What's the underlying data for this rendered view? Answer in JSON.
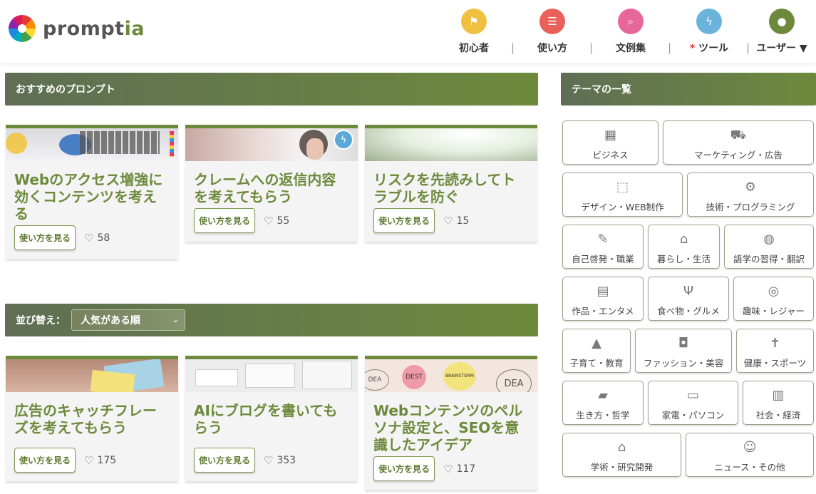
{
  "header": {
    "logo_text_main": "prompt",
    "logo_text_accent": "ia",
    "nav": [
      {
        "label": "初心者",
        "icon": "flag-icon",
        "color": "#f0c040",
        "glyph": "⚑"
      },
      {
        "label": "使い方",
        "icon": "list-icon",
        "color": "#e8625a",
        "glyph": "☰"
      },
      {
        "label": "文例集",
        "icon": "search-icon",
        "color": "#e7679a",
        "glyph": "⌕"
      },
      {
        "label": "ツール",
        "star": "*",
        "icon": "bolt-icon",
        "color": "#6ab4dc",
        "glyph": "ϟ"
      },
      {
        "label": "ユーザー ▼",
        "icon": "user-icon",
        "color": "#6d8a3c",
        "glyph": "●"
      }
    ],
    "separator": "|"
  },
  "recommended": {
    "heading": "おすすめのプロンプト",
    "cards": [
      {
        "title": "Webのアクセス増強に効くコンテンツを考える",
        "button": "使い方を見る",
        "likes": "58"
      },
      {
        "title": "クレームへの返信内容を考えてもらう",
        "button": "使い方を見る",
        "likes": "55"
      },
      {
        "title": "リスクを先読みしてトラブルを防ぐ",
        "button": "使い方を見る",
        "likes": "15"
      }
    ]
  },
  "sort": {
    "label": "並び替え：",
    "selected": "人気がある順"
  },
  "list": {
    "cards": [
      {
        "title": "広告のキャッチフレーズを考えてもらう",
        "button": "使い方を見る",
        "likes": "175"
      },
      {
        "title": "AIにブログを書いてもらう",
        "button": "使い方を見る",
        "likes": "353"
      },
      {
        "title": "Webコンテンツのペルソナ設定と、SEOを意識したアイデア",
        "button": "使い方を見る",
        "likes": "117"
      }
    ],
    "image_words": [
      "DEA",
      "DEST",
      "BRAINSTORM",
      "DEA"
    ]
  },
  "themes": {
    "heading": "テーマの一覧",
    "items": [
      {
        "label": "ビジネス",
        "icon": "building-icon",
        "glyph": "▦"
      },
      {
        "label": "マーケティング・広告",
        "icon": "shopping-bag-icon",
        "glyph": "⛟"
      },
      {
        "label": "デザイン・WEB制作",
        "icon": "vector-icon",
        "glyph": "⬚"
      },
      {
        "label": "技術・プログラミング",
        "icon": "gear-icon",
        "glyph": "⚙"
      },
      {
        "label": "自己啓発・職業",
        "icon": "magic-wand-icon",
        "glyph": "✎"
      },
      {
        "label": "暮らし・生活",
        "icon": "home-icon",
        "glyph": "⌂"
      },
      {
        "label": "語学の習得・翻訳",
        "icon": "globe-icon",
        "glyph": "◍"
      },
      {
        "label": "作品・エンタメ",
        "icon": "film-icon",
        "glyph": "▤"
      },
      {
        "label": "食べ物・グルメ",
        "icon": "utensils-icon",
        "glyph": "Ψ"
      },
      {
        "label": "趣味・レジャー",
        "icon": "compass-icon",
        "glyph": "◎"
      },
      {
        "label": "子育て・教育",
        "icon": "graduation-cap-icon",
        "glyph": "▲"
      },
      {
        "label": "ファッション・美容",
        "icon": "cosmetics-icon",
        "glyph": "◘"
      },
      {
        "label": "健康・スポーツ",
        "icon": "person-icon",
        "glyph": "✝"
      },
      {
        "label": "生き方・哲学",
        "icon": "book-icon",
        "glyph": "▰"
      },
      {
        "label": "家電・パソコン",
        "icon": "monitor-icon",
        "glyph": "▭"
      },
      {
        "label": "社会・経済",
        "icon": "newspaper-icon",
        "glyph": "▥"
      },
      {
        "label": "学術・研究開発",
        "icon": "university-icon",
        "glyph": "⌂"
      },
      {
        "label": "ニュース・その他",
        "icon": "smile-icon",
        "glyph": "☺"
      }
    ]
  }
}
